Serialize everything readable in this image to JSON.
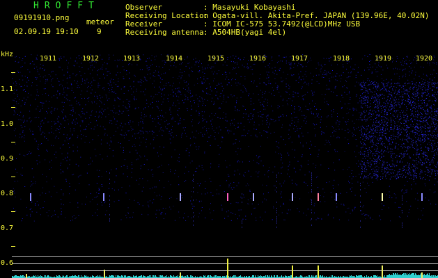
{
  "header": {
    "title": "HROFFT",
    "filename": "09191910.png",
    "datetime": "02.09.19 19:10",
    "meteor_label": "meteor",
    "meteor_count": "9",
    "info_labels": [
      "Observer",
      "Receiving Location",
      "Receiver",
      "Receiving antenna"
    ],
    "info_values": [
      ": Masayuki Kobayashi",
      ": Ogata-vill. Akita-Pref. JAPAN (139.96E, 40.02N)",
      ": ICOM IC-575 53.7492(@LCD)MHz USB",
      ": A504HB(yagi 4el)"
    ]
  },
  "axis": {
    "unit": "kHz",
    "y_labels": [
      "1.1",
      "1.0",
      "0.9",
      "0.8",
      "0.7",
      "0.6"
    ],
    "x_labels": [
      "1911",
      "1912",
      "1913",
      "1914",
      "1915",
      "1916",
      "1917",
      "1918",
      "1919",
      "1920"
    ]
  },
  "colors": {
    "text": "#ffff3c",
    "title": "#32e632",
    "background": "#000000",
    "noise": "#1a1adc"
  }
}
